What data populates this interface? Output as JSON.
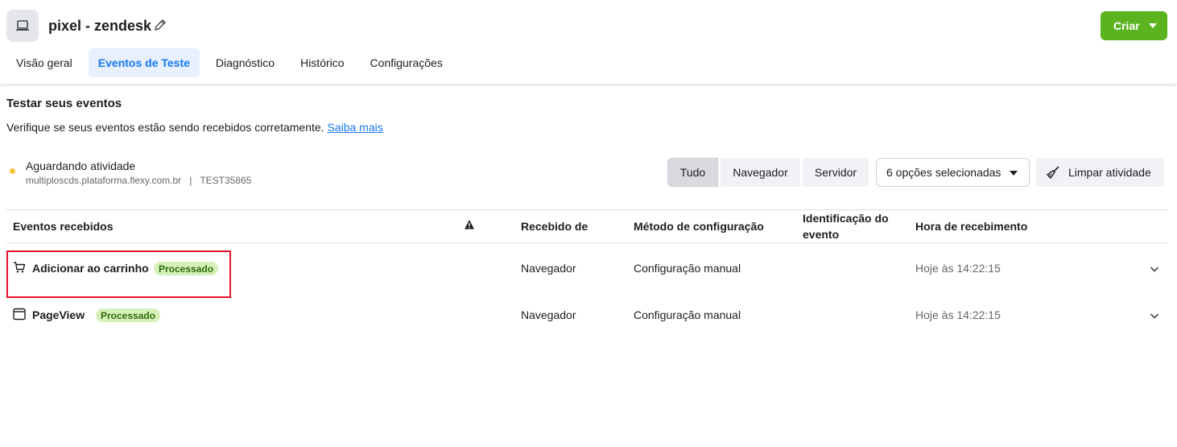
{
  "header": {
    "title": "pixel - zendesk",
    "create_label": "Criar",
    "app_icon": "laptop-icon",
    "edit_icon": "pencil-icon"
  },
  "tabs": [
    {
      "label": "Visão geral",
      "active": false
    },
    {
      "label": "Eventos de Teste",
      "active": true
    },
    {
      "label": "Diagnóstico",
      "active": false
    },
    {
      "label": "Histórico",
      "active": false
    },
    {
      "label": "Configurações",
      "active": false
    }
  ],
  "test_section": {
    "title": "Testar seus eventos",
    "description": "Verifique se seus eventos estão sendo recebidos corretamente.",
    "learn_more": "Saiba mais"
  },
  "status": {
    "label": "Aguardando atividade",
    "domain": "multiploscds.plataforma.flexy.com.br",
    "separator": "|",
    "test_code": "TEST35865"
  },
  "filters": {
    "all": "Tudo",
    "browser": "Navegador",
    "server": "Servidor",
    "options_selected": "6 opções selecionadas",
    "clear_activity": "Limpar atividade"
  },
  "table": {
    "headers": {
      "events": "Eventos recebidos",
      "received_from": "Recebido de",
      "config_method": "Método de configuração",
      "event_id_line1": "Identificação do",
      "event_id_line2": "evento",
      "received_time": "Hora de recebimento"
    },
    "rows": [
      {
        "icon": "cart-icon",
        "name": "Adicionar ao carrinho",
        "status": "Processado",
        "received_from": "Navegador",
        "method": "Configuração manual",
        "time": "Hoje às 14:22:15"
      },
      {
        "icon": "browser-window-icon",
        "name": "PageView",
        "status": "Processado",
        "received_from": "Navegador",
        "method": "Configuração manual",
        "time": "Hoje às 14:22:15"
      }
    ]
  },
  "colors": {
    "accent": "#1877f2",
    "create": "#5ab31f",
    "status_dot": "#f5c33b",
    "badge_bg": "#d5f0b8",
    "highlight": "#e4132c"
  }
}
